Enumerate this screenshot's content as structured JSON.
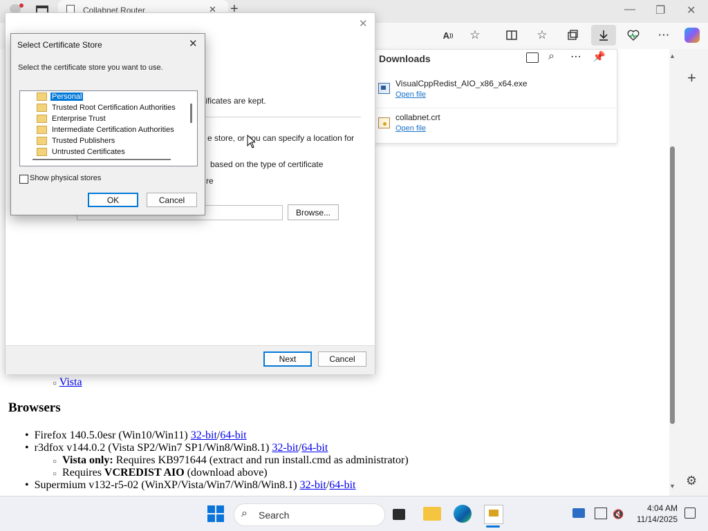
{
  "browser": {
    "tab_title": "Collabnet Router",
    "new_tab": "+",
    "win_min": "—",
    "win_max": "❐",
    "win_close": "✕",
    "toolbar_icons": [
      "read-aloud-icon",
      "favorite-star-icon",
      "split-screen-icon",
      "favorites-icon",
      "collections-icon",
      "downloads-icon",
      "browser-essentials-icon",
      "more-icon",
      "copilot-icon"
    ],
    "more_glyph": "⋯",
    "sidebar_add": "+",
    "sidebar_settings": "⚙"
  },
  "downloads": {
    "title": "Downloads",
    "items": [
      {
        "name": "VisualCppRedist_AIO_x86_x64.exe",
        "action": "Open file"
      },
      {
        "name": "collabnet.crt",
        "action": "Open file"
      }
    ]
  },
  "wizard": {
    "close": "✕",
    "text_certs_kept": "rtificates are kept.",
    "text_store_line": "e store, or you can specify a location for",
    "text_auto_line": "based on the type of certificate",
    "text_re": "re",
    "browse_label": "Browse...",
    "next_label": "Next",
    "cancel_label": "Cancel"
  },
  "cert_dialog": {
    "title": "Select Certificate Store",
    "close": "✕",
    "instruction": "Select the certificate store you want to use.",
    "stores": [
      "Personal",
      "Trusted Root Certification Authorities",
      "Enterprise Trust",
      "Intermediate Certification Authorities",
      "Trusted Publishers",
      "Untrusted Certificates"
    ],
    "selected_index": 0,
    "show_physical_label": "Show physical stores",
    "show_physical_checked": false,
    "ok_label": "OK",
    "cancel_label": "Cancel"
  },
  "page": {
    "vista_link": "Vista",
    "browsers_heading": "Browsers",
    "firefox_text": "Firefox 140.5.0esr (Win10/Win11) ",
    "firefox_32": "32-bit",
    "sep": "/",
    "firefox_64": "64-bit",
    "r3dfox_text": "r3dfox v144.0.2 (Vista SP2/Win7 SP1/Win8/Win8.1) ",
    "r3dfox_32": "32-bit",
    "r3dfox_64": "64-bit",
    "vista_only_bold": "Vista only:",
    "vista_only_text": " Requires KB971644 (extract and run install.cmd as administrator)",
    "requires_text": "Requires ",
    "vcredist_bold": "VCREDIST AIO",
    "vcredist_tail": " (download above)",
    "supermium_text": "Supermium v132-r5-02 (WinXP/Vista/Win7/Win8/Win8.1) ",
    "supermium_32": "32-bit",
    "supermium_64": "64-bit"
  },
  "taskbar": {
    "search_placeholder": "Search",
    "time": "4:04 AM",
    "date": "11/14/2025"
  },
  "colors": {
    "accent": "#0078d7",
    "link": "#0000ee",
    "selection": "#0078d7"
  }
}
